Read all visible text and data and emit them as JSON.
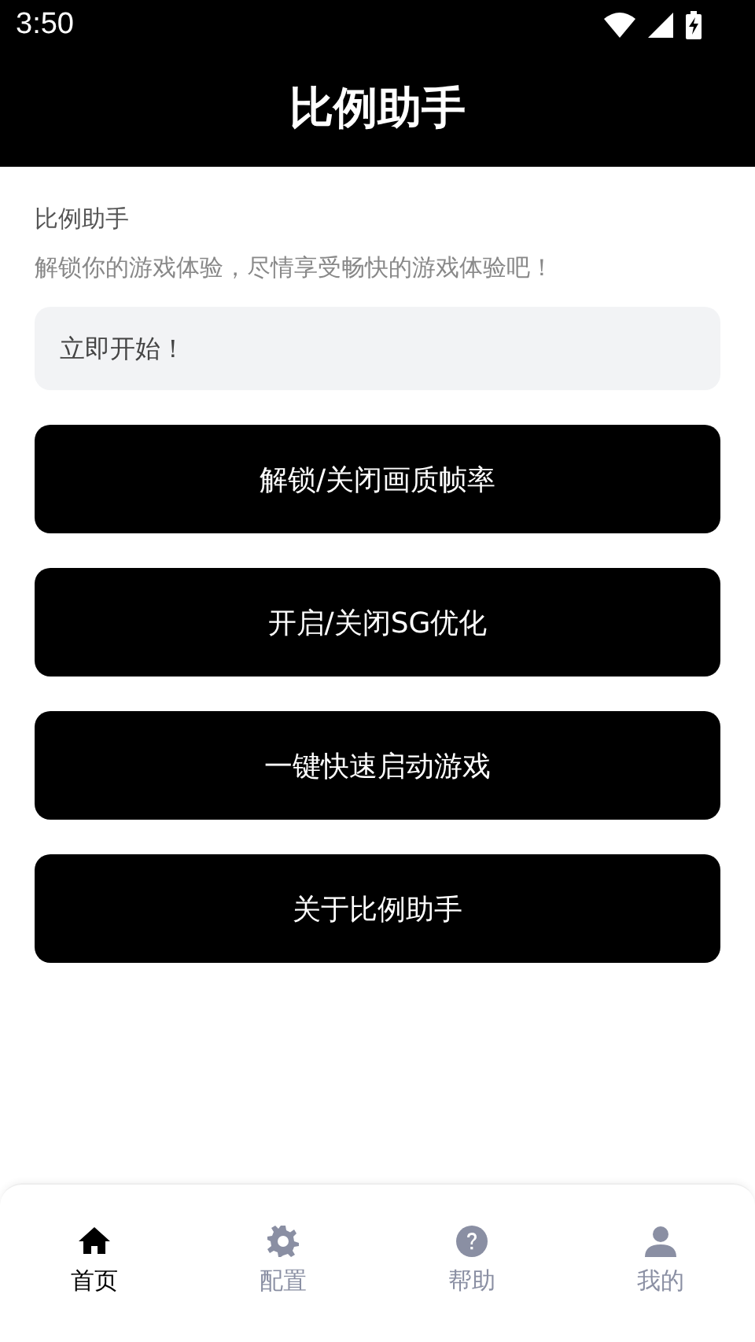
{
  "status_bar": {
    "time": "3:50"
  },
  "header": {
    "title": "比例助手"
  },
  "intro": {
    "heading": "比例助手",
    "description": "解锁你的游戏体验，尽情享受畅快的游戏体验吧！"
  },
  "notice": {
    "text": "立即开始！"
  },
  "buttons": [
    "解锁/关闭画质帧率",
    "开启/关闭SG优化",
    "一键快速启动游戏",
    "关于比例助手"
  ],
  "tab_bar": [
    {
      "label": "首页",
      "kind": "home",
      "selected": true
    },
    {
      "label": "配置",
      "kind": "gear",
      "selected": false
    },
    {
      "label": "帮助",
      "kind": "help",
      "selected": false
    },
    {
      "label": "我的",
      "kind": "person",
      "selected": false
    }
  ]
}
